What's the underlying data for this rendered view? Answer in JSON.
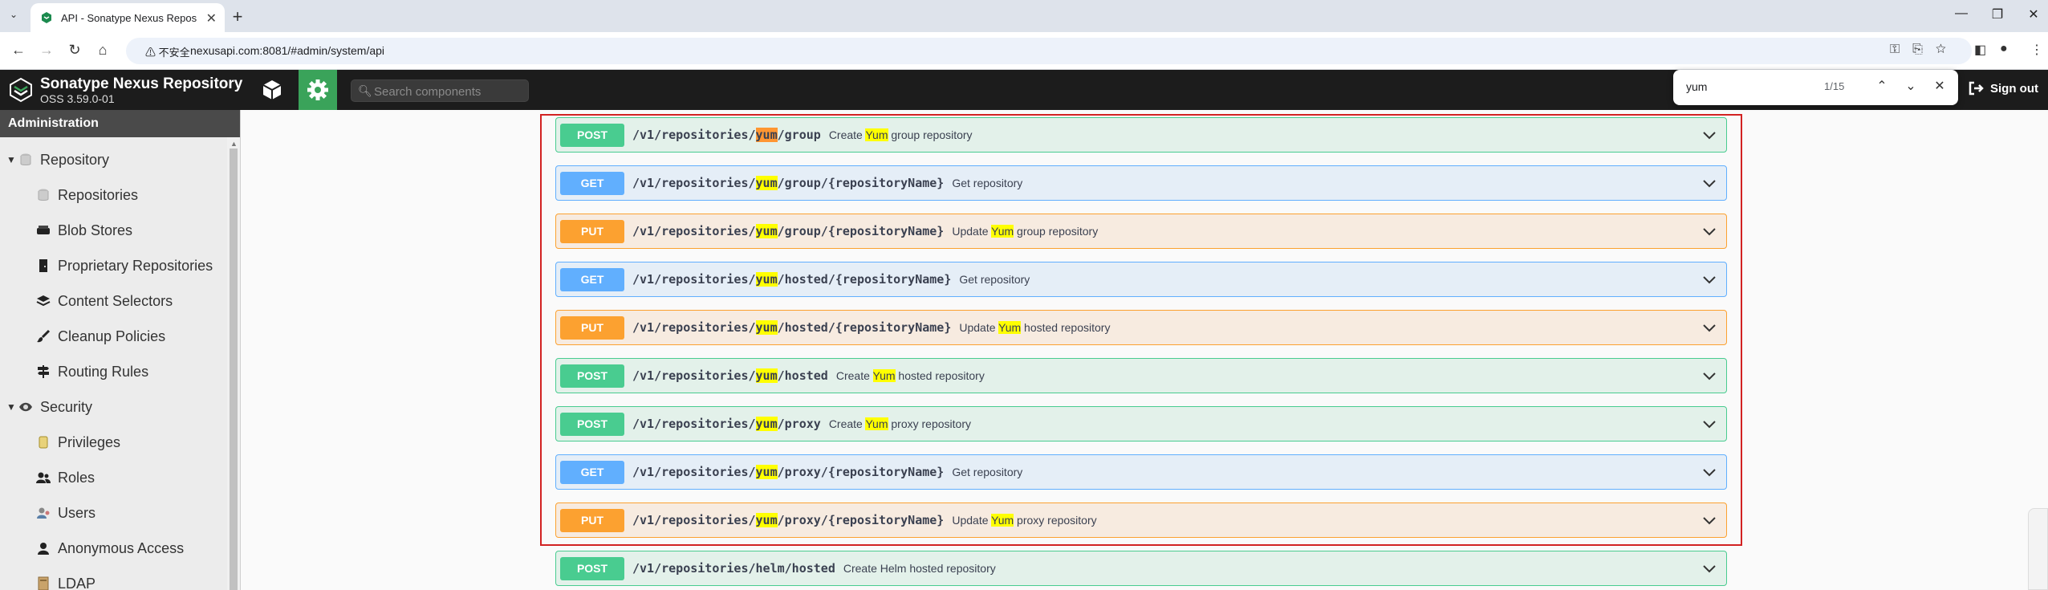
{
  "browser": {
    "tab_title": "API - Sonatype Nexus Repos",
    "security_label": "⚠ 不安全",
    "url": "nexusapi.com:8081/#admin/system/api"
  },
  "find": {
    "query": "yum",
    "count": "1/15"
  },
  "header": {
    "title": "Sonatype Nexus Repository",
    "version": "OSS 3.59.0-01",
    "search_placeholder": "Search components",
    "sign_out": "Sign out"
  },
  "sidebar": {
    "heading": "Administration",
    "items": [
      {
        "label": "Repository",
        "icon": "database-icon",
        "level": 0
      },
      {
        "label": "Repositories",
        "icon": "database-icon",
        "level": 1
      },
      {
        "label": "Blob Stores",
        "icon": "hard-drive-icon",
        "level": 1
      },
      {
        "label": "Proprietary Repositories",
        "icon": "door-icon",
        "level": 1
      },
      {
        "label": "Content Selectors",
        "icon": "layers-icon",
        "level": 1
      },
      {
        "label": "Cleanup Policies",
        "icon": "brush-icon",
        "level": 1
      },
      {
        "label": "Routing Rules",
        "icon": "signpost-icon",
        "level": 1
      },
      {
        "label": "Security",
        "icon": "eye-icon",
        "level": 0
      },
      {
        "label": "Privileges",
        "icon": "badge-icon",
        "level": 1
      },
      {
        "label": "Roles",
        "icon": "users-icon",
        "level": 1
      },
      {
        "label": "Users",
        "icon": "user-group-icon",
        "level": 1
      },
      {
        "label": "Anonymous Access",
        "icon": "user-icon",
        "level": 1
      },
      {
        "label": "LDAP",
        "icon": "book-icon",
        "level": 1
      }
    ]
  },
  "operations": [
    {
      "method": "POST",
      "path_pre": "/v1/repositories/",
      "path_hl": "yum",
      "path_post": "/group",
      "desc_pre": "Create ",
      "desc_hl": "Yum",
      "desc_post": " group repository",
      "active": true
    },
    {
      "method": "GET",
      "path_pre": "/v1/repositories/",
      "path_hl": "yum",
      "path_post": "/group/{repositoryName}",
      "desc_pre": "Get repository",
      "desc_hl": "",
      "desc_post": ""
    },
    {
      "method": "PUT",
      "path_pre": "/v1/repositories/",
      "path_hl": "yum",
      "path_post": "/group/{repositoryName}",
      "desc_pre": "Update ",
      "desc_hl": "Yum",
      "desc_post": " group repository"
    },
    {
      "method": "GET",
      "path_pre": "/v1/repositories/",
      "path_hl": "yum",
      "path_post": "/hosted/{repositoryName}",
      "desc_pre": "Get repository",
      "desc_hl": "",
      "desc_post": ""
    },
    {
      "method": "PUT",
      "path_pre": "/v1/repositories/",
      "path_hl": "yum",
      "path_post": "/hosted/{repositoryName}",
      "desc_pre": "Update ",
      "desc_hl": "Yum",
      "desc_post": " hosted repository"
    },
    {
      "method": "POST",
      "path_pre": "/v1/repositories/",
      "path_hl": "yum",
      "path_post": "/hosted",
      "desc_pre": "Create ",
      "desc_hl": "Yum",
      "desc_post": " hosted repository"
    },
    {
      "method": "POST",
      "path_pre": "/v1/repositories/",
      "path_hl": "yum",
      "path_post": "/proxy",
      "desc_pre": "Create ",
      "desc_hl": "Yum",
      "desc_post": " proxy repository"
    },
    {
      "method": "GET",
      "path_pre": "/v1/repositories/",
      "path_hl": "yum",
      "path_post": "/proxy/{repositoryName}",
      "desc_pre": "Get repository",
      "desc_hl": "",
      "desc_post": ""
    },
    {
      "method": "PUT",
      "path_pre": "/v1/repositories/",
      "path_hl": "yum",
      "path_post": "/proxy/{repositoryName}",
      "desc_pre": "Update ",
      "desc_hl": "Yum",
      "desc_post": " proxy repository"
    },
    {
      "method": "POST",
      "path_pre": "/v1/repositories/helm/hosted",
      "path_hl": "",
      "path_post": "",
      "desc_pre": "Create Helm hosted repository",
      "desc_hl": "",
      "desc_post": ""
    }
  ],
  "colors": {
    "post": "#49cc90",
    "get": "#61affe",
    "put": "#fca130",
    "highlight_border": "#d22222",
    "admin_active": "#3aa35a"
  }
}
